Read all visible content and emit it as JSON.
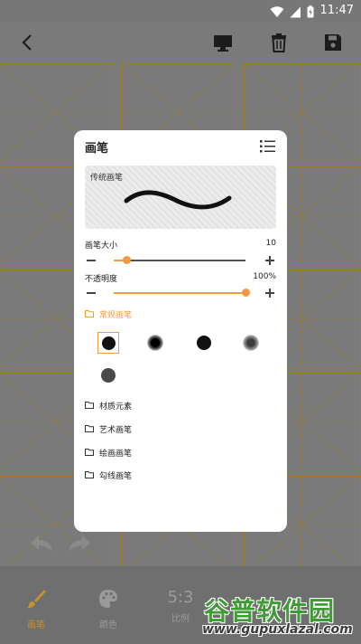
{
  "status_bar": {
    "time": "11:47",
    "icons": [
      "wifi-icon",
      "signal-icon",
      "battery-icon"
    ]
  },
  "toolbar": {
    "icons": [
      "back-arrow-icon",
      "monitor-icon",
      "trash-icon",
      "save-icon"
    ]
  },
  "brush_panel": {
    "title": "画笔",
    "preview_label": "传统画笔",
    "size": {
      "label": "画笔大小",
      "value": "10",
      "fraction": 0.1
    },
    "opacity": {
      "label": "不透明度",
      "value": "100%",
      "fraction": 1.0
    },
    "active_category": "常规画笔",
    "brushes": [
      {
        "name": "solid-round-brush",
        "selected": true
      },
      {
        "name": "soft-round-brush",
        "selected": false
      },
      {
        "name": "hard-round-brush",
        "selected": false
      },
      {
        "name": "airbrush-brush",
        "selected": false
      },
      {
        "name": "gray-round-brush",
        "selected": false
      }
    ],
    "categories": [
      "材质元素",
      "艺术画笔",
      "绘画画笔",
      "勾线画笔"
    ]
  },
  "bottom_bar": {
    "tabs": [
      {
        "label": "画笔",
        "icon": "brush-icon",
        "active": true
      },
      {
        "label": "颜色",
        "icon": "palette-icon",
        "active": false
      },
      {
        "label": "比例",
        "icon_text": "5:3",
        "active": false
      }
    ]
  },
  "watermark": {
    "title": "谷普软件园",
    "url": "www.gupuxlazal.com"
  },
  "colors": {
    "accent": "#f19a3e",
    "grid_line": "#9c7d28",
    "overlay": "#7a7a7a"
  }
}
